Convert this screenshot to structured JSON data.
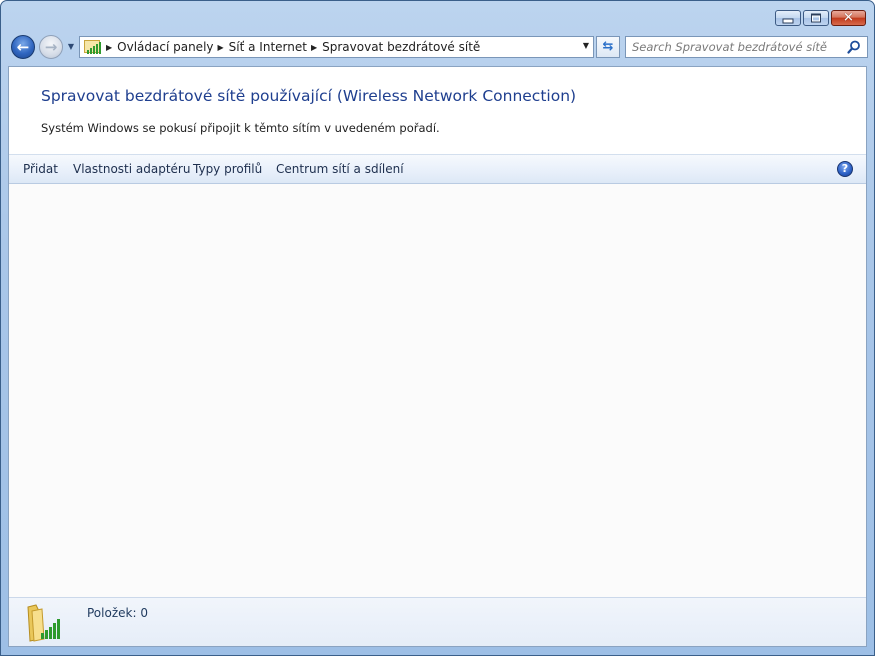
{
  "window": {
    "caption_buttons": [
      "minimize",
      "maximize",
      "close"
    ],
    "close_glyph": "✕"
  },
  "nav": {
    "back_glyph": "←",
    "forward_glyph": "→",
    "breadcrumbs": [
      "Ovládací panely",
      "Síť a Internet",
      "Spravovat bezdrátové sítě"
    ],
    "breadcrumb_icon": "network-signal-icon",
    "search_placeholder": "Search Spravovat bezdrátové sítě"
  },
  "page": {
    "title": "Spravovat bezdrátové sítě používající (Wireless Network Connection)",
    "subtitle": "Systém Windows se pokusí připojit k těmto sítím v uvedeném pořadí."
  },
  "toolbar": {
    "items": [
      "Přidat",
      "Vlastnosti adaptéru",
      "Typy profilů",
      "Centrum sítí a sdílení"
    ],
    "help_glyph": "?"
  },
  "details": {
    "item_count": "Položek: 0",
    "icon": "wireless-folder-icon"
  },
  "colors": {
    "title_blue": "#1f3f8f",
    "frame_blue": "#a9c6e8",
    "signal_green": "#2e9a2e"
  }
}
